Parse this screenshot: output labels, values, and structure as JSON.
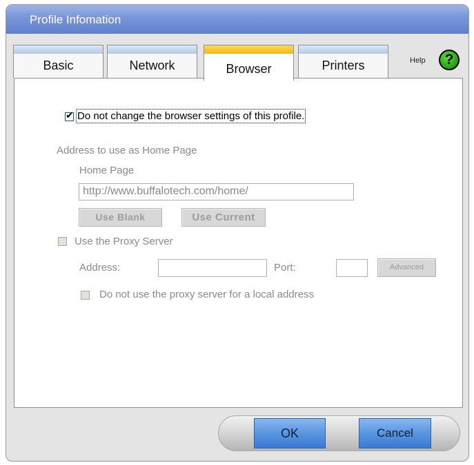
{
  "window": {
    "title": "Profile Infomation"
  },
  "tabs": [
    {
      "label": "Basic",
      "active": false
    },
    {
      "label": "Network",
      "active": false
    },
    {
      "label": "Browser",
      "active": true
    },
    {
      "label": "Printers",
      "active": false
    }
  ],
  "help": {
    "label": "Help",
    "icon": "question-icon",
    "glyph": "?"
  },
  "browser": {
    "no_change": {
      "label": "Do not change the browser settings of this profile.",
      "checked": true
    },
    "home_section_label": "Address to use as Home Page",
    "home_page_label": "Home Page",
    "home_page_value": "http://www.buffalotech.com/home/",
    "use_blank_label": "Use Blank",
    "use_current_label": "Use Current",
    "proxy": {
      "use_label": "Use the Proxy Server",
      "checked": false,
      "address_label": "Address:",
      "address_value": "",
      "port_label": "Port:",
      "port_value": "",
      "advanced_label": "Advanced",
      "bypass_local_label": "Do not use the proxy server for a local address",
      "bypass_checked": false
    }
  },
  "footer": {
    "ok_label": "OK",
    "cancel_label": "Cancel"
  },
  "colors": {
    "title_bar": "#7895d8",
    "active_tab_accent": "#f5b517",
    "tab_accent": "#b4c8ea",
    "button_blue": "#5a95e0",
    "help_green": "#2aa81a"
  }
}
